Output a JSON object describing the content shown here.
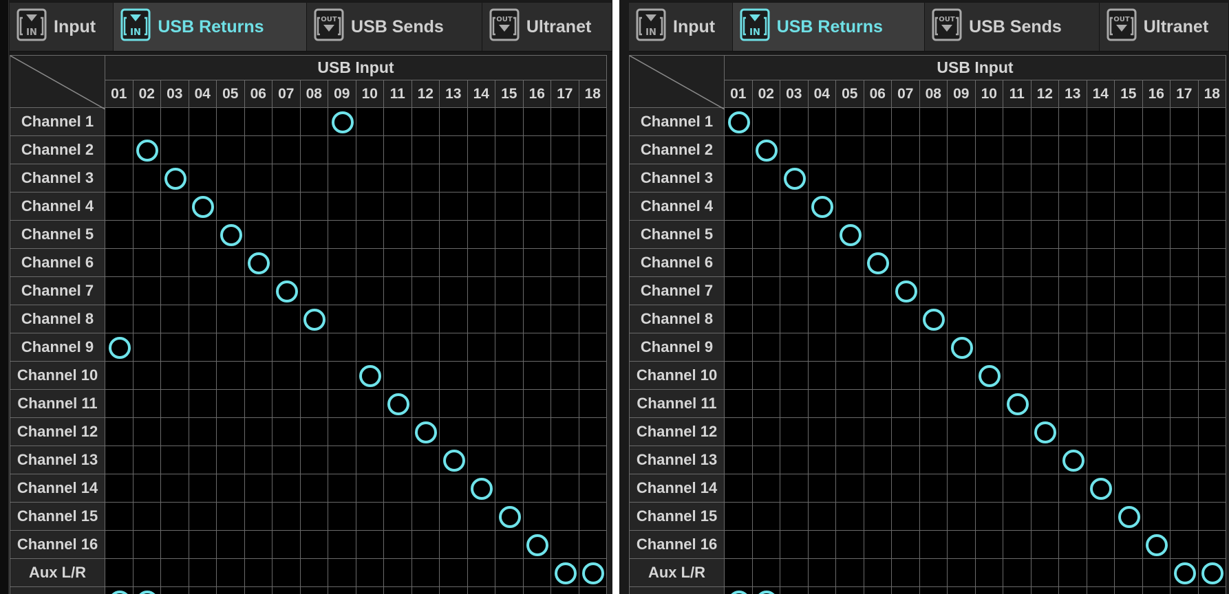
{
  "accent_color": "#6fe0e6",
  "panels": [
    {
      "tabs": [
        {
          "label": "Input",
          "icon": "input-in-icon",
          "badge": "IN",
          "active": false
        },
        {
          "label": "USB Returns",
          "icon": "usb-return-in-icon",
          "badge": "IN",
          "active": true
        },
        {
          "label": "USB Sends",
          "icon": "usb-send-out-icon",
          "badge": "OUT",
          "active": false
        },
        {
          "label": "Ultranet",
          "icon": "ultranet-out-icon",
          "badge": "OUT",
          "active": false
        }
      ],
      "header_title": "USB Input",
      "columns": [
        "01",
        "02",
        "03",
        "04",
        "05",
        "06",
        "07",
        "08",
        "09",
        "10",
        "11",
        "12",
        "13",
        "14",
        "15",
        "16",
        "17",
        "18"
      ],
      "rows": [
        {
          "label": "Channel 1",
          "routed": [
            "09"
          ]
        },
        {
          "label": "Channel 2",
          "routed": [
            "02"
          ]
        },
        {
          "label": "Channel 3",
          "routed": [
            "03"
          ]
        },
        {
          "label": "Channel 4",
          "routed": [
            "04"
          ]
        },
        {
          "label": "Channel 5",
          "routed": [
            "05"
          ]
        },
        {
          "label": "Channel 6",
          "routed": [
            "06"
          ]
        },
        {
          "label": "Channel 7",
          "routed": [
            "07"
          ]
        },
        {
          "label": "Channel 8",
          "routed": [
            "08"
          ]
        },
        {
          "label": "Channel 9",
          "routed": [
            "01"
          ]
        },
        {
          "label": "Channel 10",
          "routed": [
            "10"
          ]
        },
        {
          "label": "Channel 11",
          "routed": [
            "11"
          ]
        },
        {
          "label": "Channel 12",
          "routed": [
            "12"
          ]
        },
        {
          "label": "Channel 13",
          "routed": [
            "13"
          ]
        },
        {
          "label": "Channel 14",
          "routed": [
            "14"
          ]
        },
        {
          "label": "Channel 15",
          "routed": [
            "15"
          ]
        },
        {
          "label": "Channel 16",
          "routed": [
            "16"
          ]
        },
        {
          "label": "Aux L/R",
          "routed": [
            "17",
            "18"
          ]
        }
      ],
      "partial_row_routed": [
        "01",
        "02"
      ]
    },
    {
      "tabs": [
        {
          "label": "Input",
          "icon": "input-in-icon",
          "badge": "IN",
          "active": false
        },
        {
          "label": "USB Returns",
          "icon": "usb-return-in-icon",
          "badge": "IN",
          "active": true
        },
        {
          "label": "USB Sends",
          "icon": "usb-send-out-icon",
          "badge": "OUT",
          "active": false
        },
        {
          "label": "Ultranet",
          "icon": "ultranet-out-icon",
          "badge": "OUT",
          "active": false
        }
      ],
      "header_title": "USB Input",
      "columns": [
        "01",
        "02",
        "03",
        "04",
        "05",
        "06",
        "07",
        "08",
        "09",
        "10",
        "11",
        "12",
        "13",
        "14",
        "15",
        "16",
        "17",
        "18"
      ],
      "rows": [
        {
          "label": "Channel 1",
          "routed": [
            "01"
          ]
        },
        {
          "label": "Channel 2",
          "routed": [
            "02"
          ]
        },
        {
          "label": "Channel 3",
          "routed": [
            "03"
          ]
        },
        {
          "label": "Channel 4",
          "routed": [
            "04"
          ]
        },
        {
          "label": "Channel 5",
          "routed": [
            "05"
          ]
        },
        {
          "label": "Channel 6",
          "routed": [
            "06"
          ]
        },
        {
          "label": "Channel 7",
          "routed": [
            "07"
          ]
        },
        {
          "label": "Channel 8",
          "routed": [
            "08"
          ]
        },
        {
          "label": "Channel 9",
          "routed": [
            "09"
          ]
        },
        {
          "label": "Channel 10",
          "routed": [
            "10"
          ]
        },
        {
          "label": "Channel 11",
          "routed": [
            "11"
          ]
        },
        {
          "label": "Channel 12",
          "routed": [
            "12"
          ]
        },
        {
          "label": "Channel 13",
          "routed": [
            "13"
          ]
        },
        {
          "label": "Channel 14",
          "routed": [
            "14"
          ]
        },
        {
          "label": "Channel 15",
          "routed": [
            "15"
          ]
        },
        {
          "label": "Channel 16",
          "routed": [
            "16"
          ]
        },
        {
          "label": "Aux L/R",
          "routed": [
            "17",
            "18"
          ]
        }
      ],
      "partial_row_routed": [
        "01",
        "02"
      ]
    }
  ]
}
